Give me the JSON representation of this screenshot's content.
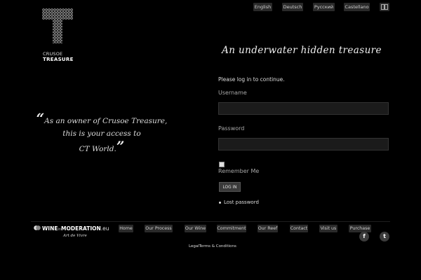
{
  "languages": [
    "English",
    "Deutsch",
    "Русский",
    "Castellano"
  ],
  "brand": {
    "line1": "CRUSOE",
    "line2": "TREASURE"
  },
  "tagline": "An underwater hidden treasure",
  "quote": {
    "open_mark": "“",
    "line1": "As an owner of Crusoe Treasure,",
    "line2": "this is your access to",
    "line3": "CT World.",
    "close_mark": "”"
  },
  "login": {
    "intro": "Please log in to continue.",
    "username_label": "Username",
    "username_value": "",
    "password_label": "Password",
    "password_value": "",
    "remember_label": "Remember Me",
    "remember_checked": true,
    "button_label": "LOG IN",
    "lost_password": "Lost password"
  },
  "footer": {
    "wim": {
      "name_part1": "WINE",
      "name_mid": "in",
      "name_part2": "MODERATION",
      "name_suffix": ".eu",
      "subtitle": "Art de Vivre"
    },
    "nav": [
      "Home",
      "Our Process",
      "Our Wine",
      "Commitment",
      "Our Reef",
      "Contact",
      "Visit us",
      "Purchase"
    ],
    "social": {
      "facebook": "f",
      "twitter": "t"
    },
    "legal": {
      "legal": "Legal",
      "terms": "Terms & Conditions"
    }
  },
  "colors": {
    "background": "#000000",
    "button": "#2a2a2a",
    "text": "#dddddd"
  }
}
